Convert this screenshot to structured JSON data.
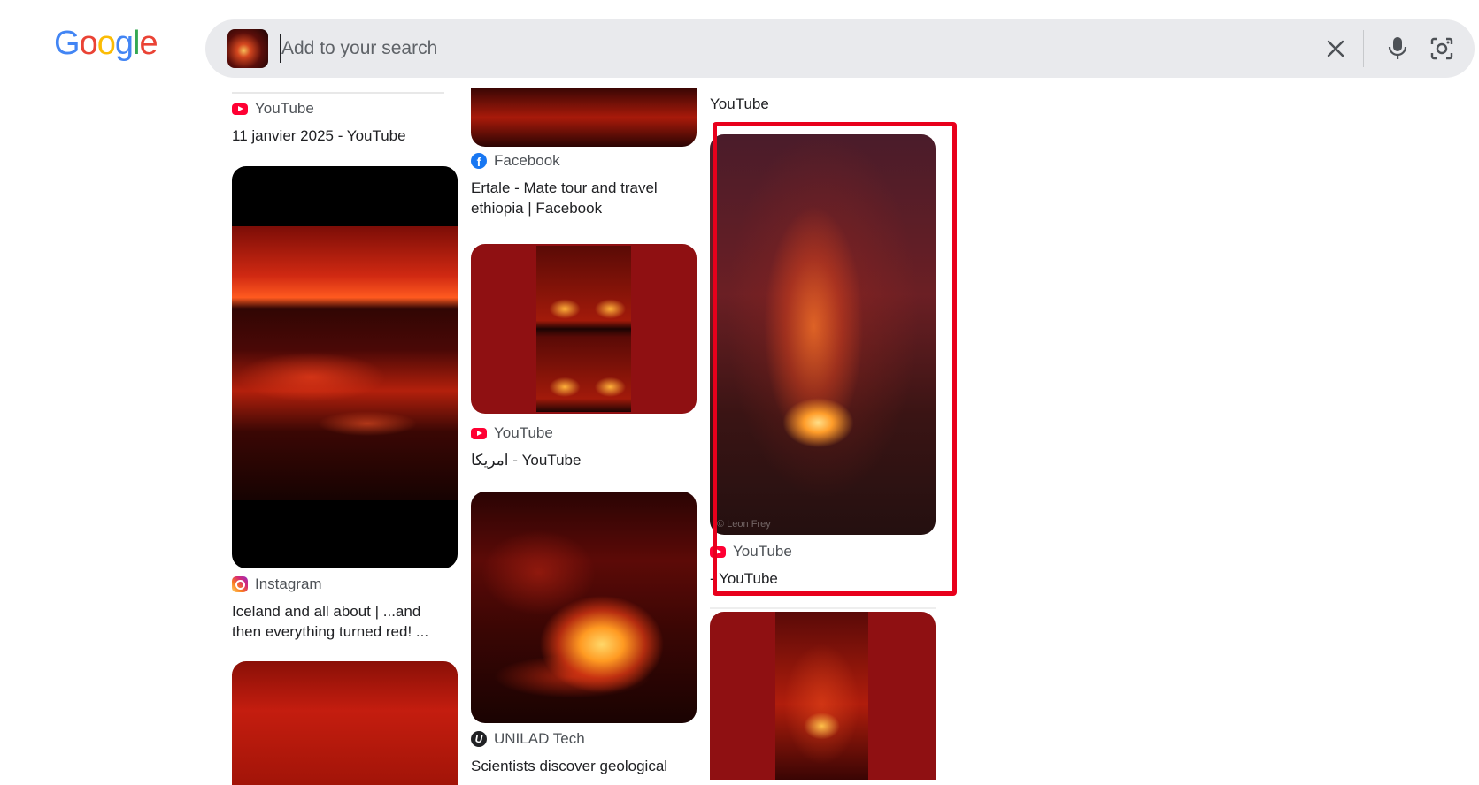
{
  "logo": {
    "letters": [
      "G",
      "o",
      "o",
      "g",
      "l",
      "e"
    ],
    "colors": [
      "#4285f4",
      "#ea4335",
      "#fbbc05",
      "#4285f4",
      "#34a853",
      "#ea4335"
    ]
  },
  "search": {
    "placeholder": "Add to your search",
    "value": ""
  },
  "icons": {
    "clear": "close-icon",
    "voice": "microphone-icon",
    "lens": "lens-camera-icon"
  },
  "columns": {
    "col1": {
      "card1": {
        "source": "YouTube",
        "title": "11 janvier 2025 - YouTube"
      },
      "card2": {
        "source": "Instagram",
        "title": "Iceland and all about | ...and then everything turned red! ..."
      },
      "card3": {}
    },
    "col2": {
      "card1": {
        "source": "Facebook",
        "title": "Ertale - Mate tour and travel ethiopia | Facebook"
      },
      "card2": {
        "source": "YouTube",
        "title": "امريكا - YouTube"
      },
      "card3": {
        "source": "UNILAD Tech",
        "title": "Scientists discover geological"
      }
    },
    "col3": {
      "card0": {
        "title": "YouTube"
      },
      "card1": {
        "source": "YouTube",
        "title": "- YouTube",
        "watermark": "© Leon Frey"
      },
      "card2": {}
    }
  },
  "highlight_color": "#e8001c"
}
